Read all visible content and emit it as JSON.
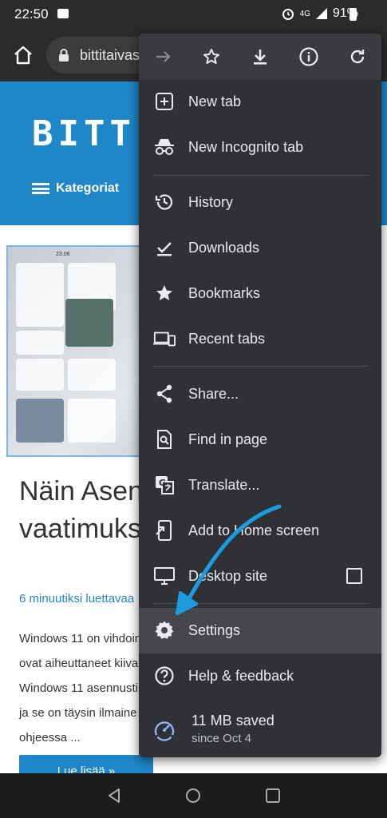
{
  "status_bar": {
    "time": "22:50",
    "network": "4G",
    "battery": "91%"
  },
  "browser": {
    "url": "bittitaivas"
  },
  "page": {
    "logo": "BITT",
    "category_label": "Kategoriat",
    "thumbnail_date": "23.06",
    "article_title": "Näin Asen HELPOST vaatimuks",
    "read_time": "6 minuutiksi luettavaa",
    "excerpt_lines": [
      "Windows 11 on vihdoin",
      "ovat aiheuttaneet kiiva",
      "Windows 11 asennusti",
      "ja se on täysin ilmaine",
      "ohjeessa ..."
    ],
    "read_more": "Lue lisää »"
  },
  "menu": {
    "toolbar_icons": [
      "forward-icon",
      "star-icon",
      "download-icon",
      "info-icon",
      "refresh-icon"
    ],
    "items": [
      {
        "label": "New tab",
        "icon": "new-tab-icon"
      },
      {
        "label": "New Incognito tab",
        "icon": "incognito-icon"
      },
      {
        "label": "History",
        "icon": "history-icon"
      },
      {
        "label": "Downloads",
        "icon": "downloads-icon"
      },
      {
        "label": "Bookmarks",
        "icon": "bookmarks-icon"
      },
      {
        "label": "Recent tabs",
        "icon": "recent-tabs-icon"
      },
      {
        "label": "Share...",
        "icon": "share-icon"
      },
      {
        "label": "Find in page",
        "icon": "find-icon"
      },
      {
        "label": "Translate...",
        "icon": "translate-icon"
      },
      {
        "label": "Add to Home screen",
        "icon": "add-home-icon"
      },
      {
        "label": "Desktop site",
        "icon": "desktop-icon"
      },
      {
        "label": "Settings",
        "icon": "settings-icon"
      },
      {
        "label": "Help & feedback",
        "icon": "help-icon"
      }
    ],
    "desktop_site_checked": false,
    "data_saved": "11 MB saved",
    "data_saved_since": "since Oct 4"
  },
  "colors": {
    "menu_bg": "#303134",
    "highlight": "#45474a",
    "accent_blue": "#1f86c8",
    "arrow_blue": "#1e9be0"
  }
}
